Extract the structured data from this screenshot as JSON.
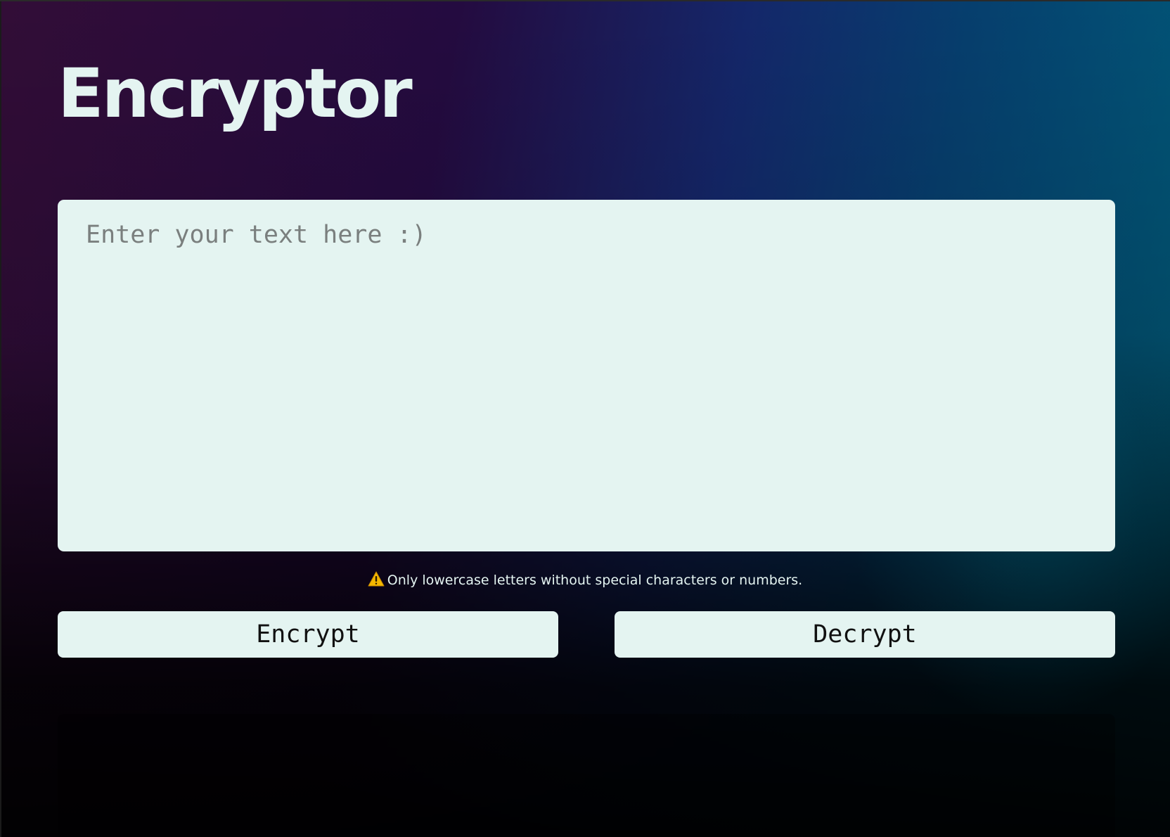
{
  "app": {
    "title": "Encryptor"
  },
  "input": {
    "value": "",
    "placeholder": "Enter your text here :)"
  },
  "warning": {
    "icon": "warning-icon",
    "text": "Only lowercase letters without special characters or numbers."
  },
  "actions": {
    "encrypt_label": "Encrypt",
    "decrypt_label": "Decrypt"
  },
  "theme": {
    "accent_light": "#e4f4f1",
    "gradient_start": "#320d37",
    "gradient_mid": "#14276a",
    "gradient_end": "#005f7b",
    "warning_color": "#f5b800"
  }
}
